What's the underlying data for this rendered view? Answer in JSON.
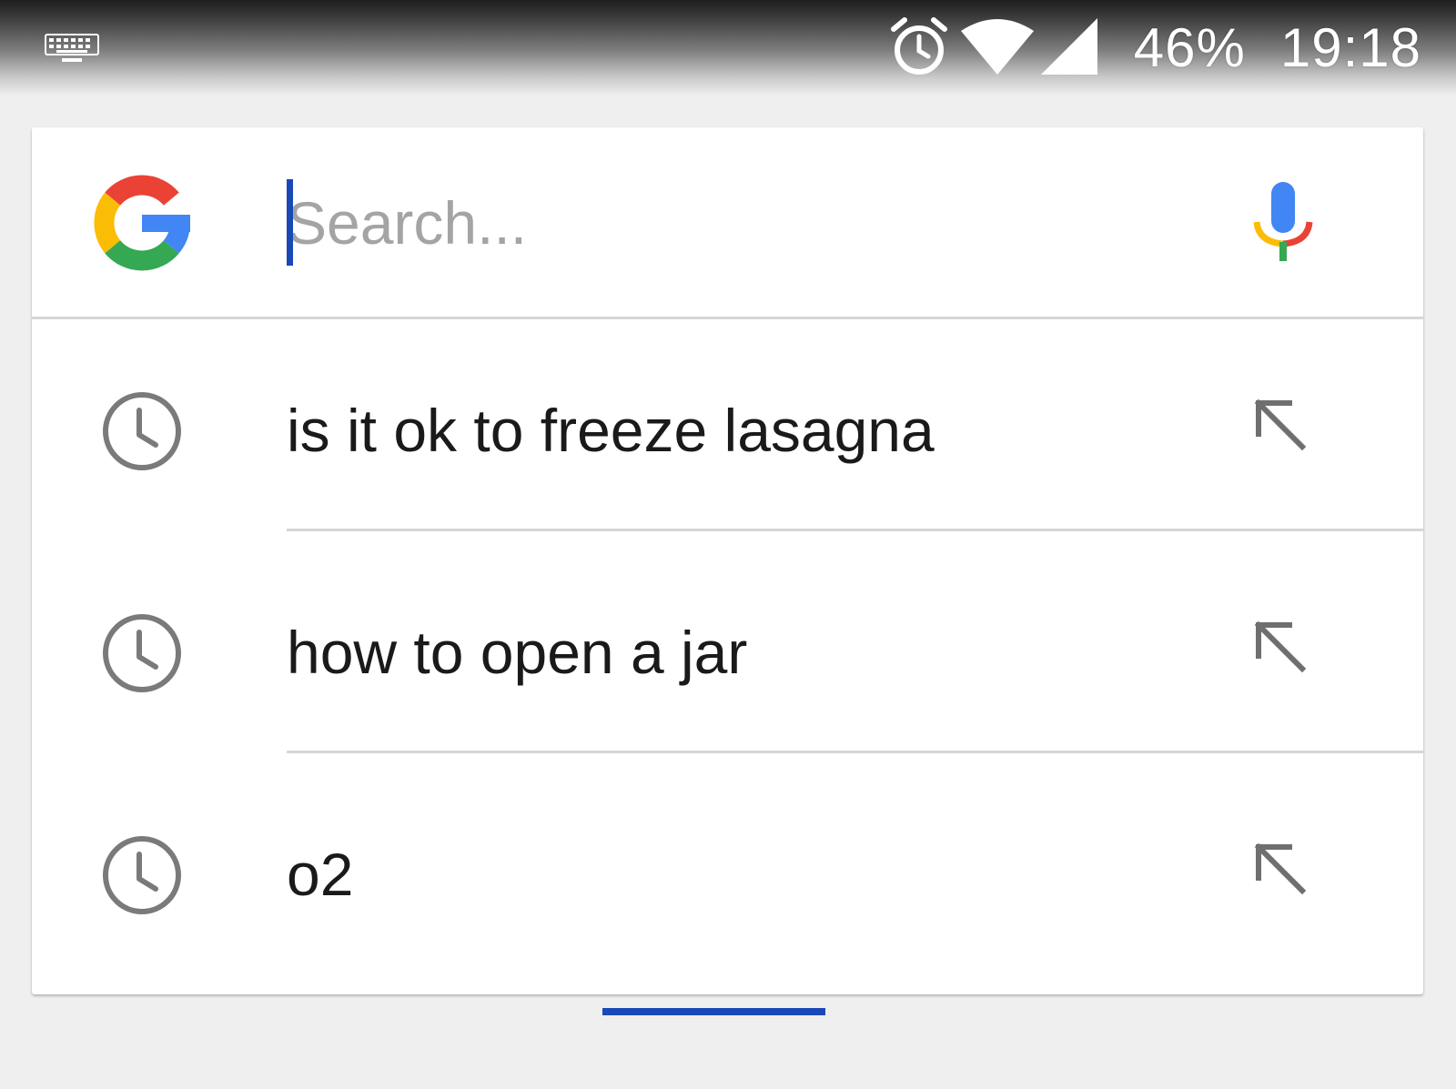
{
  "status_bar": {
    "battery": "46%",
    "time": "19:18",
    "icons": [
      "keyboard-icon",
      "alarm-icon",
      "wifi-icon",
      "cell-signal-icon"
    ]
  },
  "search": {
    "placeholder": "Search...",
    "value": "",
    "logo": "google-g-logo",
    "mic_icon": "microphone-icon"
  },
  "suggestions": [
    {
      "text": "is it ok to freeze lasagna",
      "icon": "history-icon",
      "action_icon": "fill-query-arrow-icon"
    },
    {
      "text": "how to open a jar",
      "icon": "history-icon",
      "action_icon": "fill-query-arrow-icon"
    },
    {
      "text": "o2",
      "icon": "history-icon",
      "action_icon": "fill-query-arrow-icon"
    }
  ],
  "colors": {
    "accent_blue": "#1a48b8",
    "google_blue": "#4285F4",
    "google_red": "#EA4335",
    "google_yellow": "#FBBC05",
    "google_green": "#34A853",
    "icon_gray": "#7a7a7a",
    "background": "#efefef"
  }
}
